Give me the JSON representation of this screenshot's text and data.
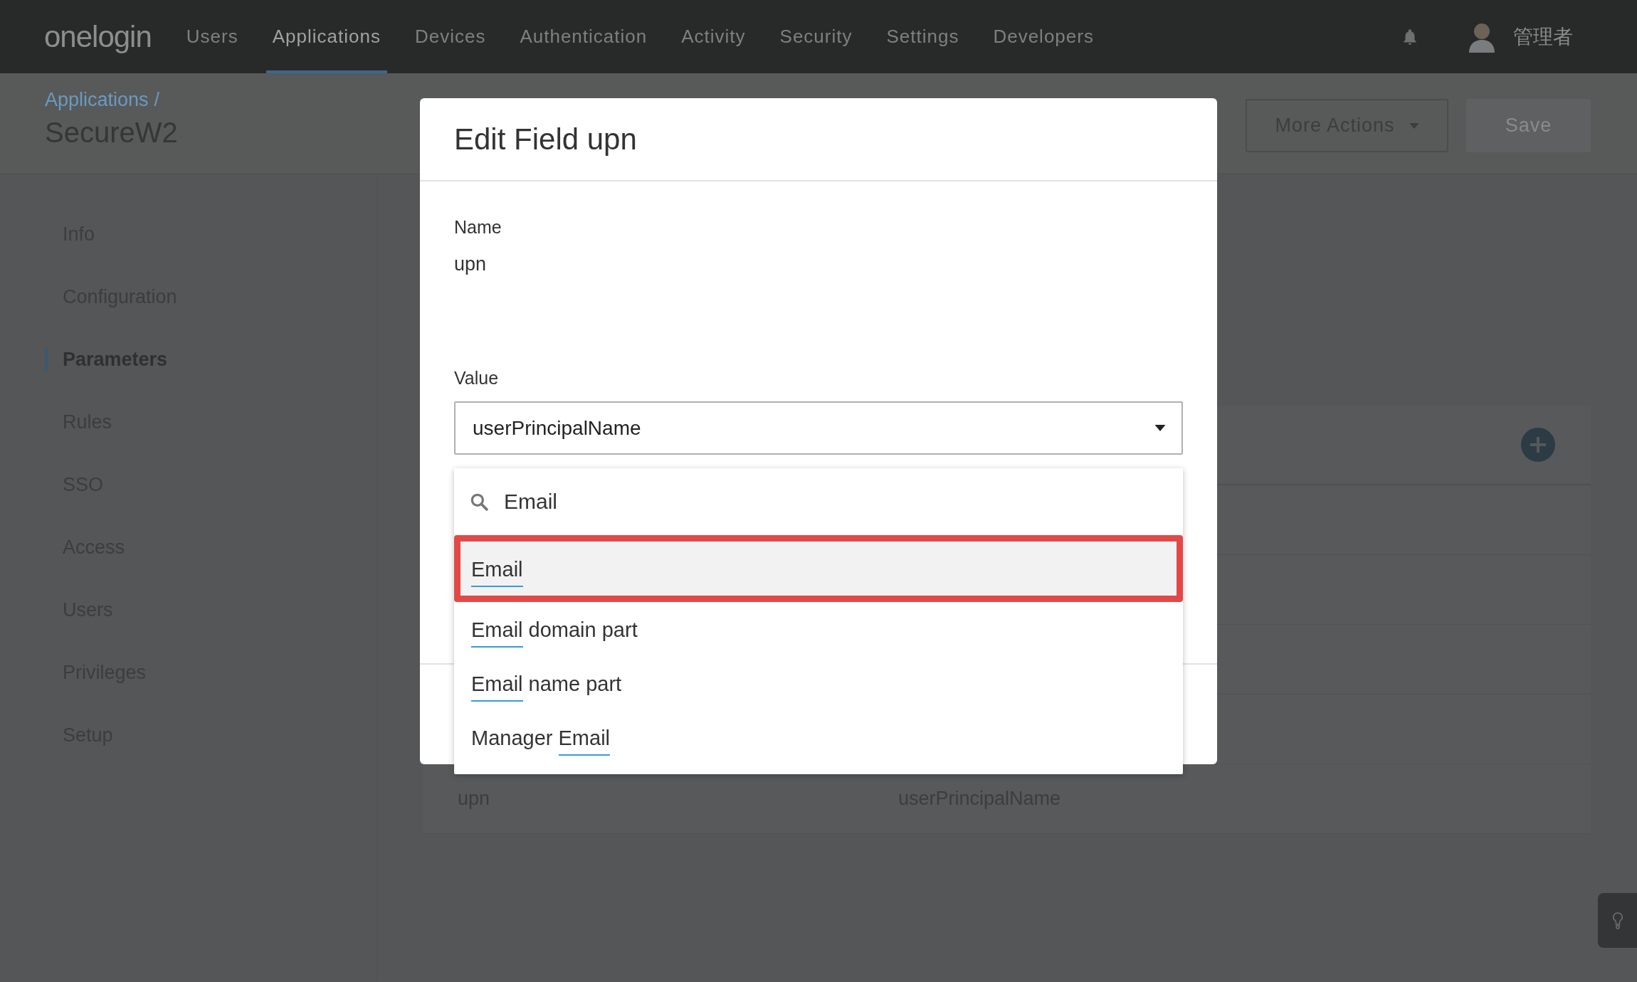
{
  "nav": {
    "logo": "onelogin",
    "items": [
      {
        "label": "Users",
        "selected": false
      },
      {
        "label": "Applications",
        "selected": true
      },
      {
        "label": "Devices",
        "selected": false
      },
      {
        "label": "Authentication",
        "selected": false
      },
      {
        "label": "Activity",
        "selected": false
      },
      {
        "label": "Security",
        "selected": false
      },
      {
        "label": "Settings",
        "selected": false
      },
      {
        "label": "Developers",
        "selected": false
      }
    ],
    "user": "管理者"
  },
  "header": {
    "breadcrumb": "Applications",
    "separator": "/",
    "title": "SecureW2",
    "buttons": [
      {
        "label": "More Actions",
        "kind": "menu",
        "disabled": false
      },
      {
        "label": "Save",
        "kind": "primary",
        "disabled": true
      }
    ]
  },
  "sidebar": {
    "items": [
      {
        "label": "Info",
        "selected": false
      },
      {
        "label": "Configuration",
        "selected": false
      },
      {
        "label": "Parameters",
        "selected": true
      },
      {
        "label": "Rules",
        "selected": false
      },
      {
        "label": "SSO",
        "selected": false
      },
      {
        "label": "Access",
        "selected": false
      },
      {
        "label": "Users",
        "selected": false
      },
      {
        "label": "Privileges",
        "selected": false
      },
      {
        "label": "Setup",
        "selected": false
      }
    ]
  },
  "table": {
    "rows": [
      {
        "name": "upn",
        "value": "userPrincipalName"
      }
    ]
  },
  "modal": {
    "title": "Edit Field upn",
    "name_label": "Name",
    "name_value": "upn",
    "value_label": "Value",
    "select": {
      "value": "userPrincipalName",
      "expanded": true
    },
    "search": {
      "value": "Email"
    },
    "options": [
      {
        "match": "Email",
        "selected": true
      },
      {
        "match": "Email",
        "suffix": " domain part",
        "selected": false
      },
      {
        "match": "Email",
        "suffix": " name part",
        "selected": false
      },
      {
        "prefix": "Manager ",
        "match": "Email",
        "selected": false
      }
    ]
  }
}
